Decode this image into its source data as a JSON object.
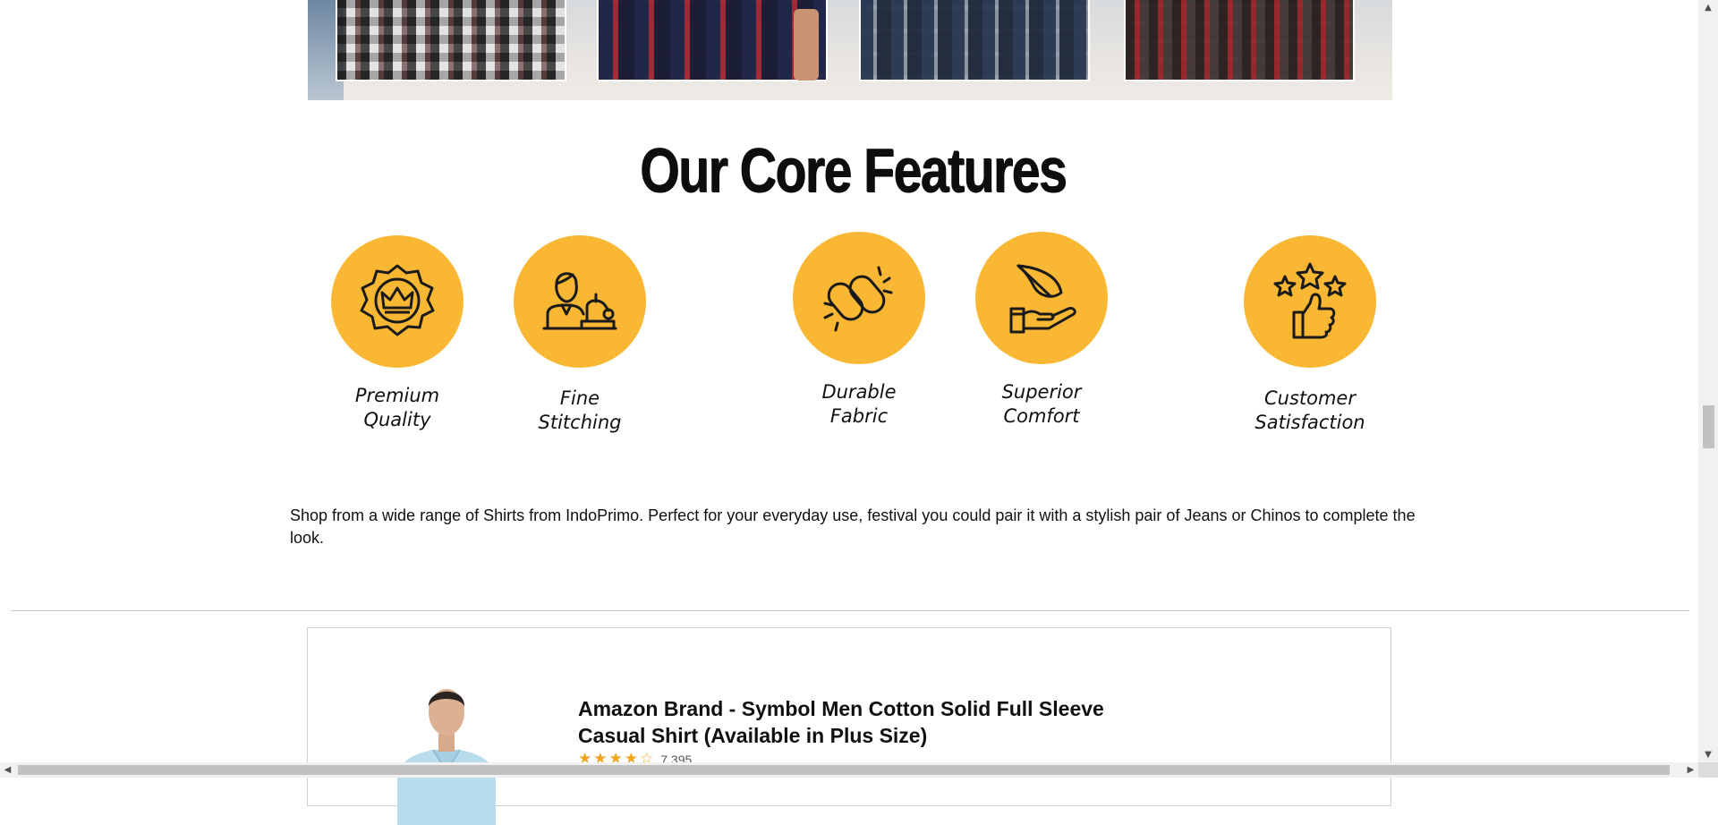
{
  "core_features": {
    "title": "Our Core Features",
    "accent_color": "#f9b733",
    "items": [
      {
        "icon": "badge-crown-icon",
        "line1": "Premium",
        "line2": "Quality"
      },
      {
        "icon": "tailor-sewing-icon",
        "line1": "Fine",
        "line2": "Stitching"
      },
      {
        "icon": "chain-link-icon",
        "line1": "Durable",
        "line2": "Fabric"
      },
      {
        "icon": "feather-hand-icon",
        "line1": "Superior",
        "line2": "Comfort"
      },
      {
        "icon": "stars-thumbs-up-icon",
        "line1": "Customer",
        "line2": "Satisfaction"
      }
    ]
  },
  "description": "Shop from a wide range of Shirts from IndoPrimo. Perfect for your everyday use, festival you could pair it with a stylish pair of Jeans or Chinos to complete the look.",
  "product": {
    "title": "Amazon Brand - Symbol Men Cotton Solid Full Sleeve Casual Shirt (Available in Plus Size)",
    "rating_stars": 4,
    "rating_count": "7,395"
  }
}
